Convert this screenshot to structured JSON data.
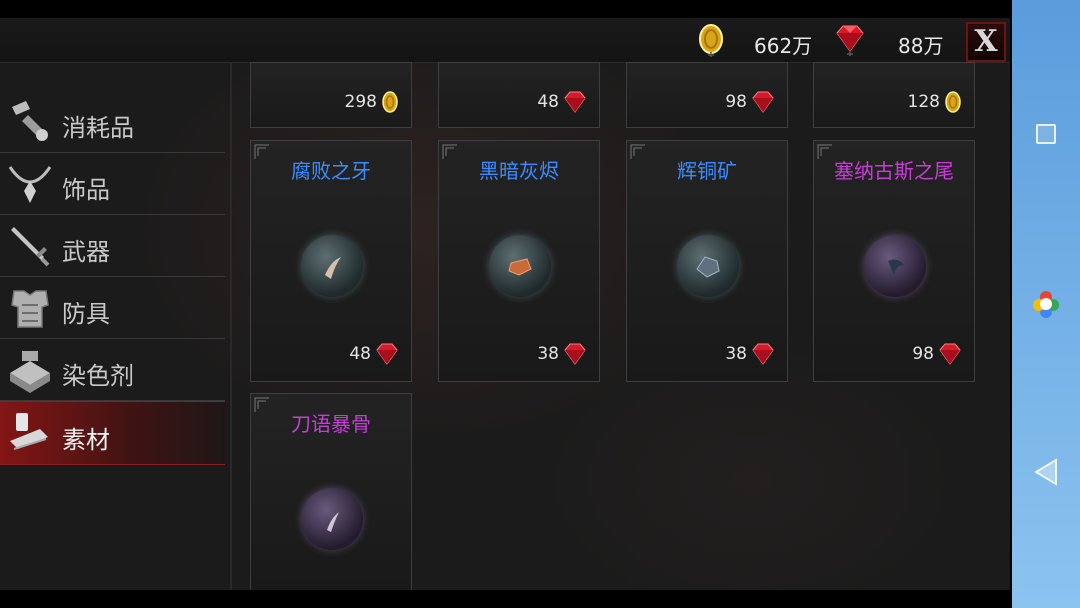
{
  "currency": {
    "gold": {
      "icon": "gold-coin-icon",
      "value": "662万"
    },
    "gem": {
      "icon": "ruby-gem-icon",
      "value": "88万"
    },
    "close_label": "X"
  },
  "categories": [
    {
      "label": "消耗品",
      "icon": "potion-scroll-icon",
      "active": false
    },
    {
      "label": "饰品",
      "icon": "necklace-icon",
      "active": false
    },
    {
      "label": "武器",
      "icon": "sword-icon",
      "active": false
    },
    {
      "label": "防具",
      "icon": "armor-icon",
      "active": false
    },
    {
      "label": "染色剂",
      "icon": "dye-pot-icon",
      "active": false
    },
    {
      "label": "素材",
      "icon": "material-bundle-icon",
      "active": true
    }
  ],
  "top_row_prices": [
    {
      "price": "298",
      "currency": "gold"
    },
    {
      "price": "48",
      "currency": "gem"
    },
    {
      "price": "98",
      "currency": "gem"
    },
    {
      "price": "128",
      "currency": "gold"
    }
  ],
  "items": [
    {
      "name": "腐败之牙",
      "rarity": "blue",
      "price": "48",
      "currency": "gem",
      "icon": "fang-icon"
    },
    {
      "name": "黑暗灰烬",
      "rarity": "blue",
      "price": "38",
      "currency": "gem",
      "icon": "ember-icon"
    },
    {
      "name": "辉铜矿",
      "rarity": "blue",
      "price": "38",
      "currency": "gem",
      "icon": "ore-icon"
    },
    {
      "name": "塞纳古斯之尾",
      "rarity": "purple",
      "price": "98",
      "currency": "gem",
      "icon": "tail-icon"
    },
    {
      "name": "刀语暴骨",
      "rarity": "purple",
      "price": "",
      "currency": "",
      "icon": "bone-icon"
    }
  ],
  "colors": {
    "rare_blue": "#3a8cff",
    "epic_purple": "#c83cd8",
    "active_tab": "#8c2020"
  }
}
